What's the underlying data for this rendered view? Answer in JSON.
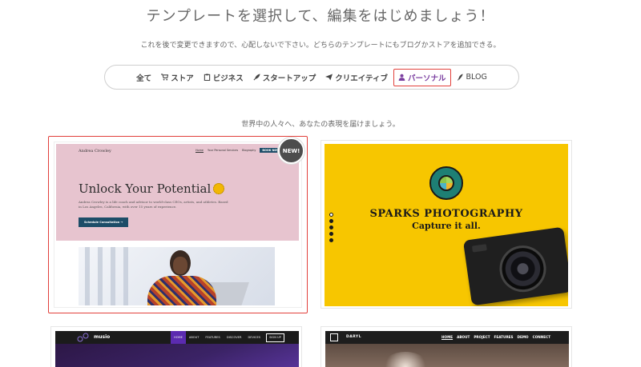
{
  "header": {
    "title": "テンプレートを選択して、編集をはじめましょう！",
    "subtitle": "これを後で変更できますので、心配しないで下さい。どちらのテンプレートにもブログかストアを追加できる。"
  },
  "filters": [
    {
      "label": "全て",
      "icon": null
    },
    {
      "label": "ストア",
      "icon": "cart-icon"
    },
    {
      "label": "ビジネス",
      "icon": "clipboard-icon"
    },
    {
      "label": "スタートアップ",
      "icon": "rocket-icon"
    },
    {
      "label": "クリエイティブ",
      "icon": "paper-plane-icon"
    },
    {
      "label": "パーソナル",
      "icon": "person-icon",
      "active": true
    },
    {
      "label": "BLOG",
      "icon": "feather-icon"
    }
  ],
  "section": {
    "tagline": "世界中の人々へ、あなたの表現を届けましょう。"
  },
  "templates": {
    "andrea": {
      "badge": "NEW!",
      "brand": "Andrea Crowley",
      "nav": [
        "Home",
        "Your Personal Services",
        "Biography",
        "BOOK NOW"
      ],
      "headline": "Unlock Your Potential",
      "description": "Andrea Crowley is a life coach and advisor to world-class CEOs, artists, and athletes. Based in Los Angeles, California, with over 15 years of experience.",
      "cta": "Schedule Consultation →"
    },
    "sparks": {
      "title": "SPARKS PHOTOGRAPHY",
      "subtitle": "Capture it all.",
      "slides": 5,
      "active_slide": 1
    },
    "musio": {
      "brand": "musio",
      "nav": [
        "HOME",
        "ABOUT",
        "FEATURES",
        "DISCOVER",
        "DEVICES"
      ],
      "signup": "SIGN UP"
    },
    "daryl": {
      "brand": "DARYL",
      "nav": [
        "HOME",
        "ABOUT",
        "PROJECT",
        "FEATURES",
        "DEMO",
        "CONNECT"
      ]
    }
  },
  "colors": {
    "active_filter_border": "#e2403b",
    "active_filter_text": "#7b3fa0",
    "selected_card_border": "#e2403b",
    "sparks_bg": "#f7c600",
    "andrea_hero_bg": "#e7c4cf"
  }
}
